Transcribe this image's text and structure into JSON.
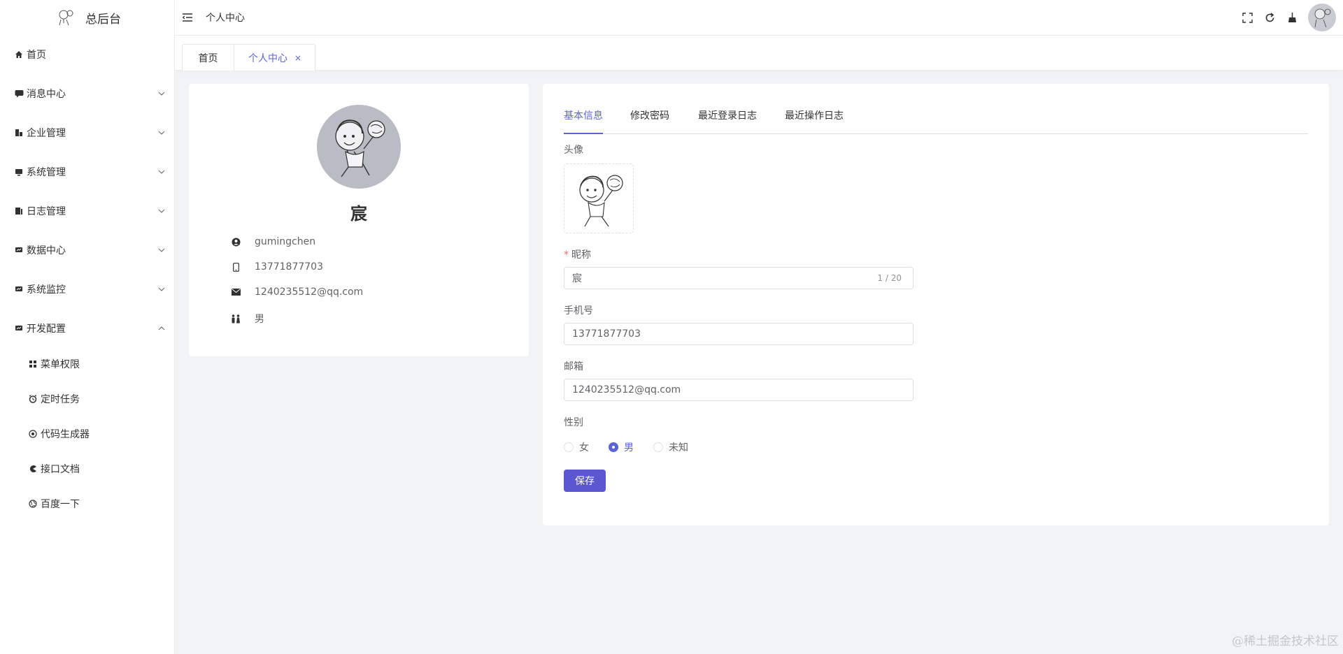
{
  "app": {
    "title": "总后台"
  },
  "sidebar": {
    "items": [
      {
        "label": "首页",
        "icon": "home-icon"
      },
      {
        "label": "消息中心",
        "icon": "message-icon"
      },
      {
        "label": "企业管理",
        "icon": "enterprise-icon"
      },
      {
        "label": "系统管理",
        "icon": "system-icon"
      },
      {
        "label": "日志管理",
        "icon": "log-icon"
      },
      {
        "label": "数据中心",
        "icon": "data-icon"
      },
      {
        "label": "系统监控",
        "icon": "monitor-icon"
      },
      {
        "label": "开发配置",
        "icon": "dev-config-icon"
      }
    ],
    "subitems": [
      {
        "label": "菜单权限",
        "icon": "grid-icon"
      },
      {
        "label": "定时任务",
        "icon": "alarm-icon"
      },
      {
        "label": "代码生成器",
        "icon": "code-icon"
      },
      {
        "label": "接口文档",
        "icon": "pacman-icon"
      },
      {
        "label": "百度一下",
        "icon": "globe-icon"
      }
    ]
  },
  "header": {
    "breadcrumb": "个人中心"
  },
  "tabs": {
    "home": "首页",
    "active": "个人中心",
    "close": "×"
  },
  "profile": {
    "nickname": "宸",
    "username": "gumingchen",
    "phone": "13771877703",
    "email": "1240235512@qq.com",
    "gender": "男"
  },
  "form": {
    "tabs": [
      "基本信息",
      "修改密码",
      "最近登录日志",
      "最近操作日志"
    ],
    "avatar_label": "头像",
    "nickname_label": "昵称",
    "nickname_required": "*",
    "nickname_value": "宸",
    "nickname_count": "1 / 20",
    "phone_label": "手机号",
    "phone_value": "13771877703",
    "email_label": "邮箱",
    "email_value": "1240235512@qq.com",
    "gender_label": "性别",
    "gender_options": [
      "女",
      "男",
      "未知"
    ],
    "gender_selected": "男",
    "save": "保存"
  },
  "watermark": "@稀土掘金技术社区",
  "colors": {
    "accent": "#5b63d6",
    "button": "#5b57d1",
    "background": "#f2f3f5"
  }
}
